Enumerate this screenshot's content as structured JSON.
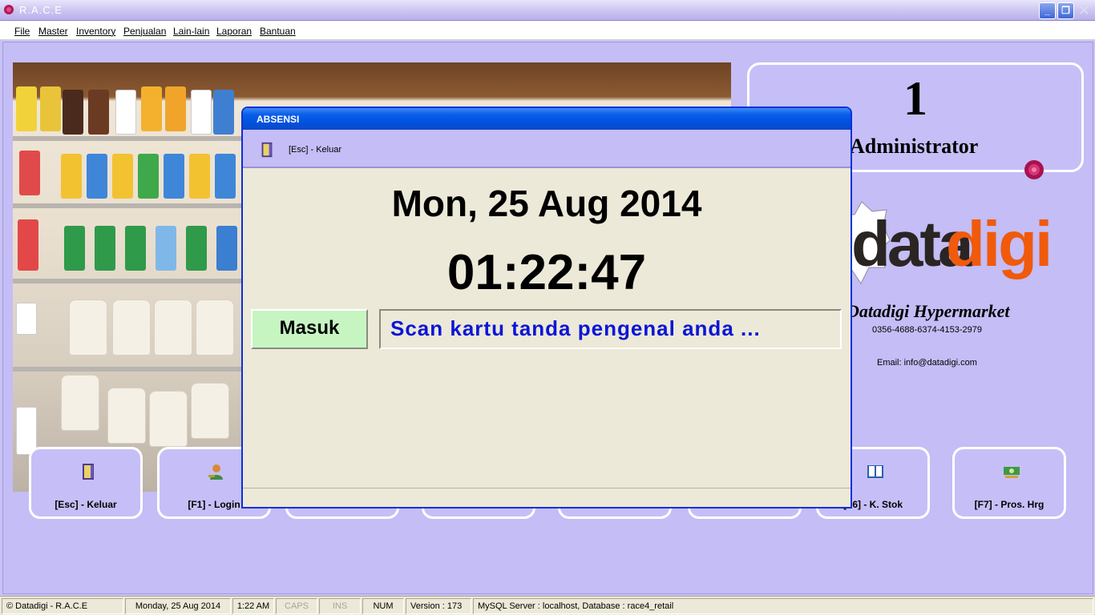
{
  "window": {
    "title": "R.A.C.E"
  },
  "menu": [
    {
      "label": "File"
    },
    {
      "label": "Master"
    },
    {
      "label": "Inventory"
    },
    {
      "label": "Penjualan"
    },
    {
      "label": "Lain-lain"
    },
    {
      "label": "Laporan"
    },
    {
      "label": "Bantuan"
    }
  ],
  "user": {
    "number": "1",
    "name": "Administrator"
  },
  "brand": {
    "logo_left": "data",
    "logo_right": "digi",
    "name": "Datadigi Hypermarket",
    "phone": "0356-4688-6374-4153-2979",
    "email": "Email: info@datadigi.com",
    "accent_color": "#f05a0c"
  },
  "shortcuts": [
    {
      "label": "[Esc] - Keluar",
      "icon": "door-exit-icon"
    },
    {
      "label": "[F1] - Login",
      "icon": "user-key-icon"
    },
    {
      "label": "[F6] - K. Stok",
      "icon": "book-icon"
    },
    {
      "label": "[F7] - Pros. Hrg",
      "icon": "money-icon"
    }
  ],
  "dialog": {
    "title": "ABSENSI",
    "toolbar_exit": "[Esc] - Keluar",
    "date": "Mon, 25 Aug 2014",
    "time": "01:22:47",
    "mode": "Masuk",
    "prompt": "Scan kartu tanda pengenal anda ..."
  },
  "status": {
    "app": "© Datadigi - R.A.C.E",
    "date": "Monday, 25 Aug 2014",
    "time": "1:22 AM",
    "caps": "CAPS",
    "ins": "INS",
    "num": "NUM",
    "version": "Version : 173",
    "db": "MySQL Server : localhost, Database : race4_retail"
  }
}
